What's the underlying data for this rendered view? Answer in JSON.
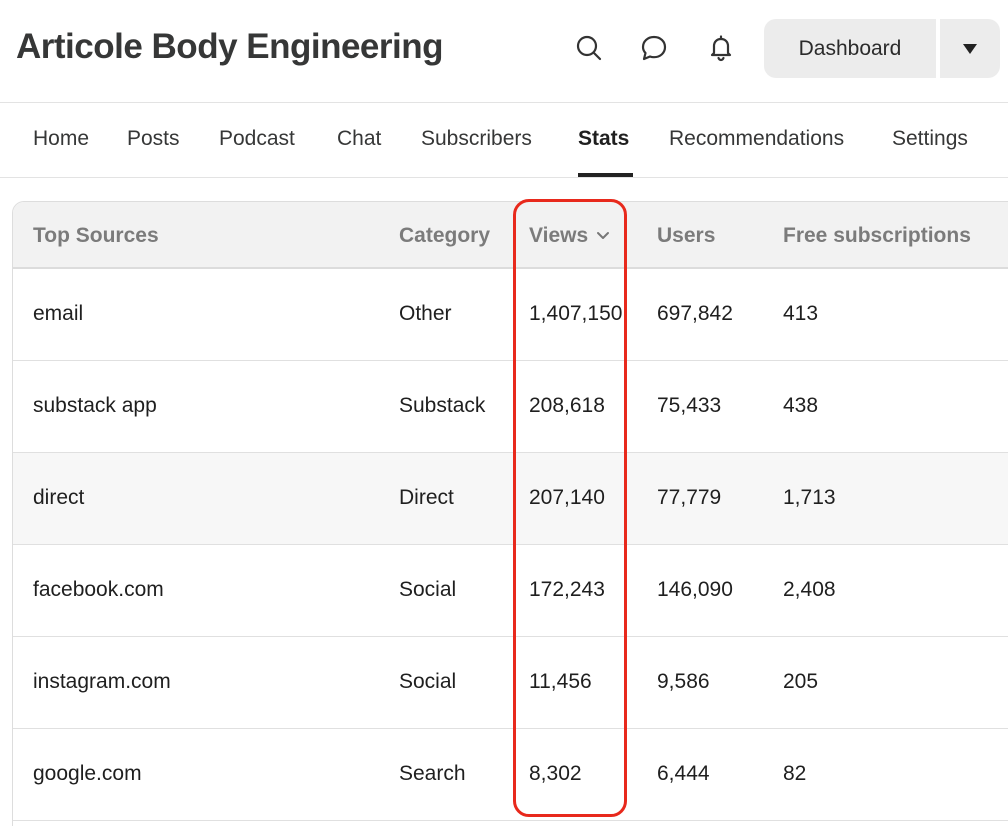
{
  "header": {
    "title": "Articole Body Engineering",
    "icons": [
      "search-icon",
      "chat-bubble-icon",
      "bell-icon"
    ],
    "dashboard_label": "Dashboard"
  },
  "nav": {
    "tabs": [
      {
        "label": "Home"
      },
      {
        "label": "Posts"
      },
      {
        "label": "Podcast"
      },
      {
        "label": "Chat"
      },
      {
        "label": "Subscribers"
      },
      {
        "label": "Stats",
        "active": true
      },
      {
        "label": "Recommendations"
      },
      {
        "label": "Settings"
      }
    ]
  },
  "table": {
    "columns": [
      "Top Sources",
      "Category",
      "Views",
      "Users",
      "Free subscriptions"
    ],
    "sorted_by": "Views",
    "rows": [
      {
        "source": "email",
        "category": "Other",
        "views": "1,407,150",
        "users": "697,842",
        "free_subs": "413"
      },
      {
        "source": "substack app",
        "category": "Substack",
        "views": "208,618",
        "users": "75,433",
        "free_subs": "438"
      },
      {
        "source": "direct",
        "category": "Direct",
        "views": "207,140",
        "users": "77,779",
        "free_subs": "1,713"
      },
      {
        "source": "facebook.com",
        "category": "Social",
        "views": "172,243",
        "users": "146,090",
        "free_subs": "2,408"
      },
      {
        "source": "instagram.com",
        "category": "Social",
        "views": "11,456",
        "users": "9,586",
        "free_subs": "205"
      },
      {
        "source": "google.com",
        "category": "Search",
        "views": "8,302",
        "users": "6,444",
        "free_subs": "82"
      }
    ]
  },
  "colors": {
    "highlight": "#e8291c",
    "header_bg": "#f2f2f2",
    "button_bg": "#ececec"
  }
}
